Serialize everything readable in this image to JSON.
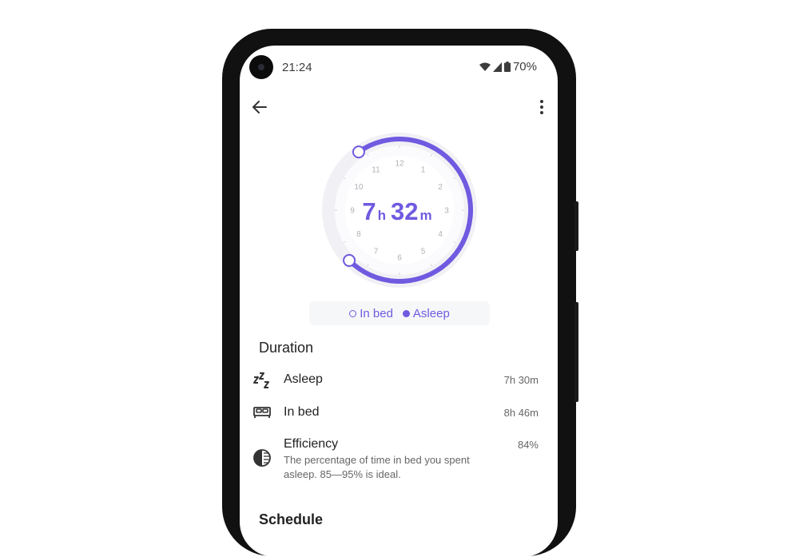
{
  "status_bar": {
    "time": "21:24",
    "battery": "70%"
  },
  "sleep": {
    "hours": "7",
    "hours_unit": "h",
    "minutes": "32",
    "minutes_unit": "m",
    "accent_color": "#6f5ae0",
    "dial_numbers": [
      "12",
      "1",
      "2",
      "3",
      "4",
      "5",
      "6",
      "7",
      "8",
      "9",
      "10",
      "11"
    ]
  },
  "legend": {
    "in_bed_label": "In bed",
    "asleep_label": "Asleep"
  },
  "duration_section": {
    "title": "Duration",
    "asleep": {
      "label": "Asleep",
      "value": "7h 30m",
      "icon": "zzz-icon"
    },
    "in_bed": {
      "label": "In bed",
      "value": "8h 46m",
      "icon": "bed-icon"
    },
    "efficiency": {
      "label": "Efficiency",
      "value": "84%",
      "description": "The percentage of time in bed you spent asleep. 85—95% is ideal.",
      "icon": "contrast-half-icon"
    }
  },
  "schedule_section": {
    "title": "Schedule"
  }
}
